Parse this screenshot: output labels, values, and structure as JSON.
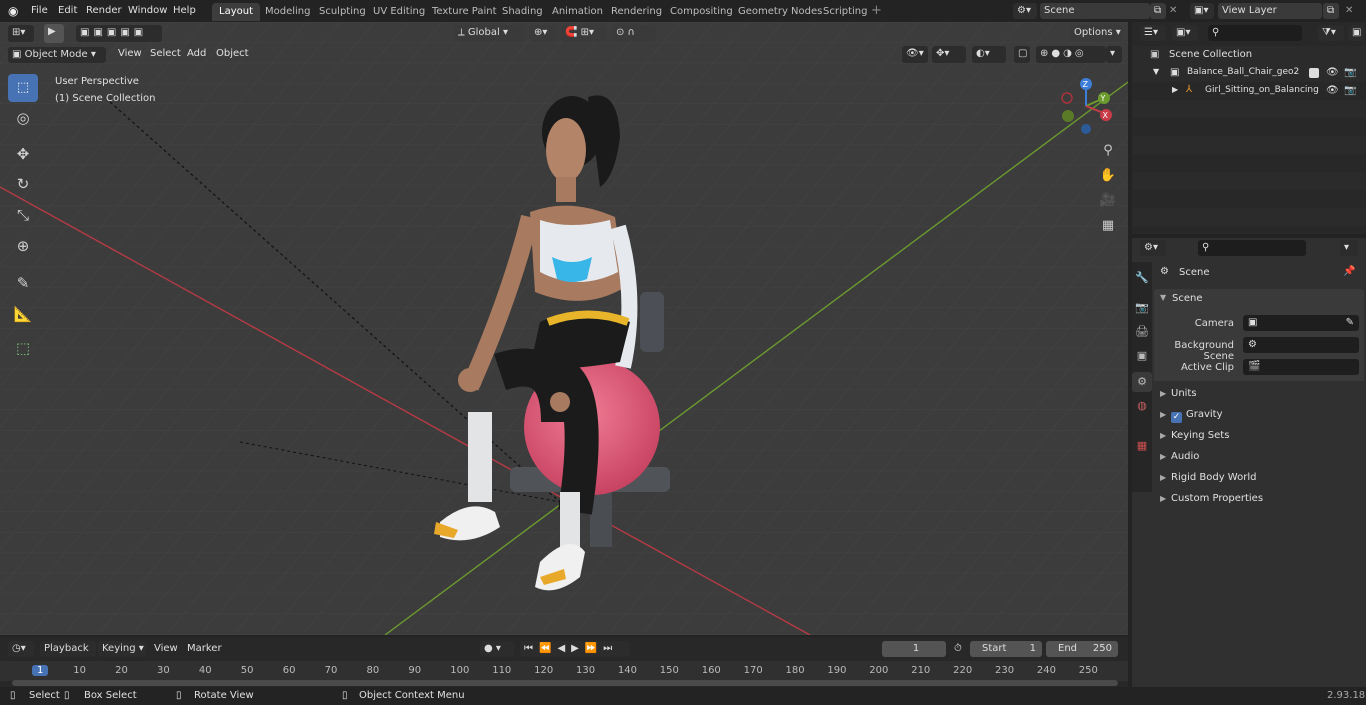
{
  "menubar": {
    "items": [
      "File",
      "Edit",
      "Render",
      "Window",
      "Help"
    ]
  },
  "workspaces": [
    "Layout",
    "Modeling",
    "Sculpting",
    "UV Editing",
    "Texture Paint",
    "Shading",
    "Animation",
    "Rendering",
    "Compositing",
    "Geometry Nodes",
    "Scripting"
  ],
  "active_workspace": "Layout",
  "scene_name": "Scene",
  "view_layer": "View Layer",
  "viewport": {
    "mode": "Object Mode",
    "menus": [
      "View",
      "Select",
      "Add",
      "Object"
    ],
    "transform_orientation": "Global",
    "options_label": "Options",
    "perspective_label": "User Perspective",
    "collection_label": "(1) Scene Collection",
    "gizmo": {
      "z": "Z",
      "y": "Y",
      "x": "X"
    }
  },
  "timeline": {
    "menus": [
      "Playback",
      "Keying",
      "View",
      "Marker"
    ],
    "current_frame": "1",
    "start_label": "Start",
    "start": "1",
    "end_label": "End",
    "end": "250",
    "ruler": [
      "1",
      "10",
      "20",
      "30",
      "40",
      "50",
      "60",
      "70",
      "80",
      "90",
      "100",
      "110",
      "120",
      "130",
      "140",
      "150",
      "160",
      "170",
      "180",
      "190",
      "200",
      "210",
      "220",
      "230",
      "240",
      "250"
    ]
  },
  "statusbar": {
    "select": "Select",
    "box_select": "Box Select",
    "rotate_view": "Rotate View",
    "context_menu": "Object Context Menu",
    "version": "2.93.18"
  },
  "outliner": {
    "root": "Scene Collection",
    "items": [
      {
        "name": "Balance_Ball_Chair_geo2"
      },
      {
        "name": "Girl_Sitting_on_Balancing"
      }
    ]
  },
  "properties": {
    "header": "Scene",
    "panel": "Scene",
    "fields": [
      {
        "label": "Camera"
      },
      {
        "label": "Background Scene"
      },
      {
        "label": "Active Clip"
      }
    ],
    "sections": [
      "Units",
      "Gravity",
      "Keying Sets",
      "Audio",
      "Rigid Body World",
      "Custom Properties"
    ]
  },
  "colors": {
    "accent": "#4772b3",
    "x_axis": "#c83c48",
    "y_axis": "#6d9c32",
    "z_axis": "#3d7fd8",
    "ball": "#e0607c"
  }
}
